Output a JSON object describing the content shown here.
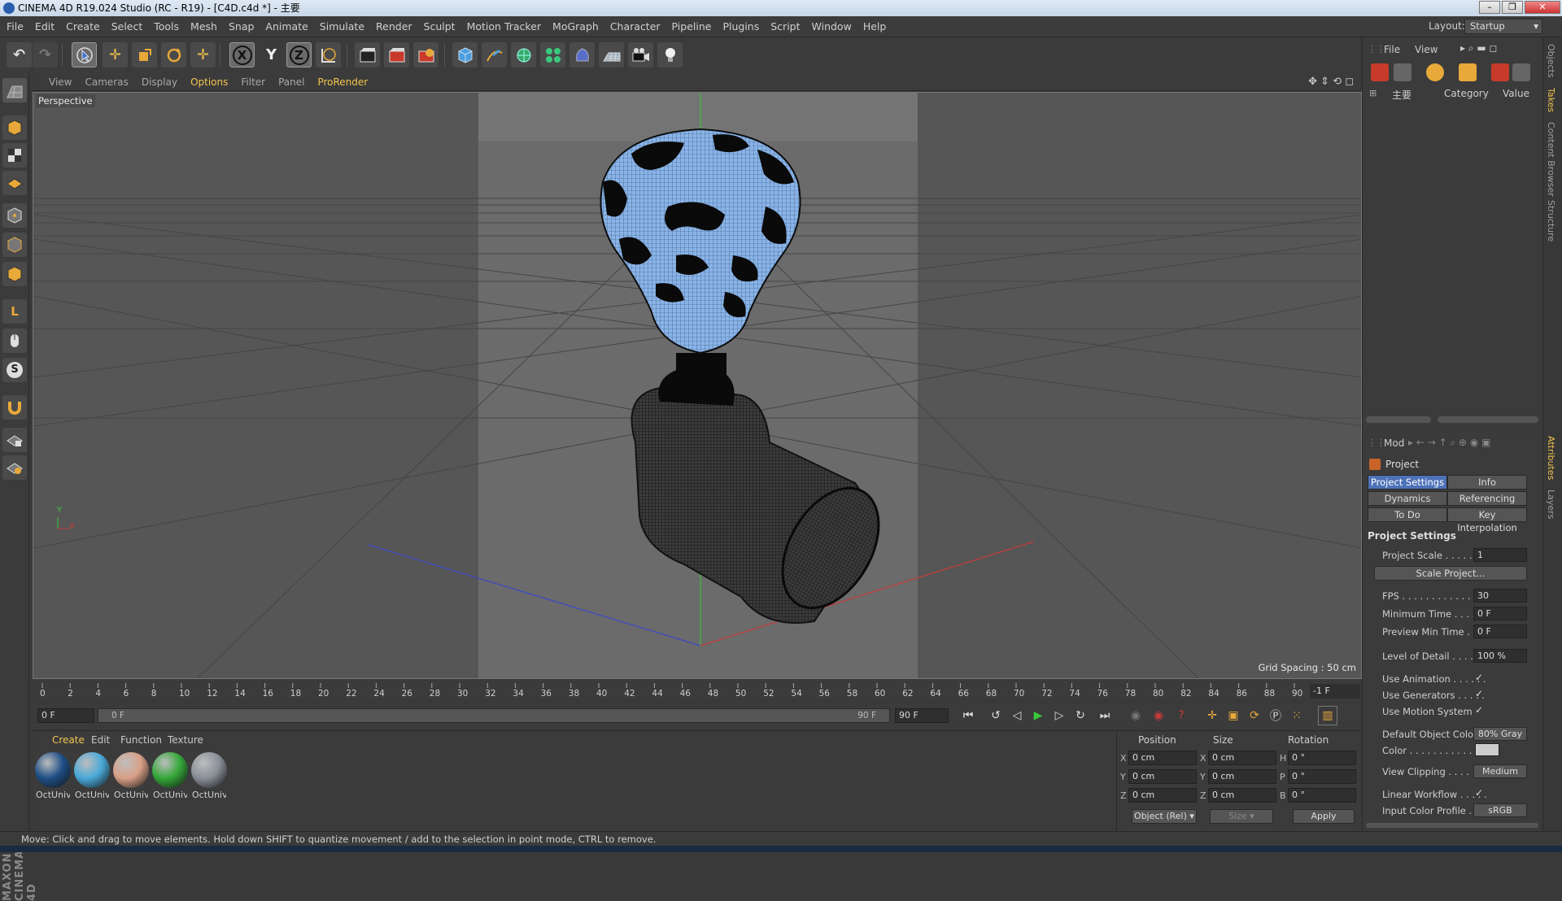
{
  "window": {
    "title": "CINEMA 4D R19.024 Studio (RC - R19) - [C4D.c4d *] - 主要"
  },
  "menubar": {
    "items": [
      "File",
      "Edit",
      "Create",
      "Select",
      "Tools",
      "Mesh",
      "Snap",
      "Animate",
      "Simulate",
      "Render",
      "Sculpt",
      "Motion Tracker",
      "MoGraph",
      "Character",
      "Pipeline",
      "Plugins",
      "Script",
      "Window",
      "Help"
    ],
    "layout_label": "Layout:",
    "layout_value": "Startup"
  },
  "toolbar": {
    "icons": [
      "undo-icon",
      "redo-icon",
      "live-selection-icon",
      "move-icon",
      "scale-icon",
      "rotate-icon",
      "move-axis-icon",
      "x-axis-lock-icon",
      "y-axis-lock-icon",
      "z-axis-lock-icon",
      "world-coordinates-icon",
      "render-view-icon",
      "render-picture-viewer-icon",
      "edit-render-settings-icon",
      "cube-icon",
      "pen-spline-icon",
      "subdivision-surface-icon",
      "cloner-icon",
      "deformer-icon",
      "floor-icon",
      "camera-icon",
      "light-icon"
    ]
  },
  "viewport": {
    "menu": [
      "View",
      "Cameras",
      "Display",
      "Options",
      "Filter",
      "Panel",
      "ProRender"
    ],
    "label": "Perspective",
    "grid_spacing": "Grid Spacing : 50 cm",
    "axis_y": "Y",
    "axis_x": "X"
  },
  "timeline": {
    "ticks": [
      "0",
      "2",
      "4",
      "6",
      "8",
      "10",
      "12",
      "14",
      "16",
      "18",
      "20",
      "22",
      "24",
      "26",
      "28",
      "30",
      "32",
      "34",
      "36",
      "38",
      "40",
      "42",
      "44",
      "46",
      "48",
      "50",
      "52",
      "54",
      "56",
      "58",
      "60",
      "62",
      "64",
      "66",
      "68",
      "70",
      "72",
      "74",
      "76",
      "78",
      "80",
      "82",
      "84",
      "86",
      "88",
      "90"
    ],
    "current_frame": "-1 F",
    "start_field": "0 F",
    "range_start": "0 F",
    "range_end": "90 F",
    "end_field": "90 F"
  },
  "materials": {
    "menu": [
      "Create",
      "Edit",
      "Function",
      "Texture"
    ],
    "items": [
      {
        "label": "OctUniv",
        "color": "#1f4f86"
      },
      {
        "label": "OctUniv",
        "color": "#4aa9d8"
      },
      {
        "label": "OctUniv",
        "color": "#d9a088"
      },
      {
        "label": "OctUniv",
        "color": "#35a83a"
      },
      {
        "label": "OctUniv",
        "color": "#8a9098"
      }
    ]
  },
  "coordinates": {
    "headers": [
      "Position",
      "Size",
      "Rotation"
    ],
    "rows": [
      {
        "axis": "X",
        "pos": "0 cm",
        "saxis": "X",
        "size": "0 cm",
        "raxis": "H",
        "rot": "0 °"
      },
      {
        "axis": "Y",
        "pos": "0 cm",
        "saxis": "Y",
        "size": "0 cm",
        "raxis": "P",
        "rot": "0 °"
      },
      {
        "axis": "Z",
        "pos": "0 cm",
        "saxis": "Z",
        "size": "0 cm",
        "raxis": "B",
        "rot": "0 °"
      }
    ],
    "mode": "Object (Rel)",
    "size_mode": "Size",
    "apply": "Apply"
  },
  "status": "Move: Click and drag to move elements. Hold down SHIFT to quantize movement / add to the selection in point mode, CTRL to remove.",
  "objects_panel": {
    "menu": [
      "File",
      "View"
    ],
    "root_item": "主要",
    "columns": [
      "Category",
      "Value"
    ]
  },
  "attributes": {
    "mode_label": "Mod",
    "object_name": "Project",
    "tabs": [
      "Project Settings",
      "Info",
      "Dynamics",
      "Referencing",
      "To Do",
      "Key Interpolation"
    ],
    "section": "Project Settings",
    "rows": [
      {
        "label": "Project Scale . . . . . . .",
        "value": "1"
      },
      {
        "label": "FPS . . . . . . . . . . . . . . .",
        "value": "30"
      },
      {
        "label": "Minimum Time . . . . . .",
        "value": "0 F"
      },
      {
        "label": "Preview Min Time . . . .",
        "value": "0 F"
      },
      {
        "label": "Level of Detail . . . . . .",
        "value": "100 %"
      },
      {
        "label": "Use Animation . . . . . .",
        "value": "✓"
      },
      {
        "label": "Use Generators . . . . .",
        "value": "✓"
      },
      {
        "label": "Use Motion System",
        "value": "✓"
      },
      {
        "label": "Default Object Color",
        "value": "80% Gray"
      },
      {
        "label": "Color . . . . . . . . . . . .",
        "value": ""
      },
      {
        "label": "View Clipping . . . . . .",
        "value": "Medium"
      },
      {
        "label": "Linear Workflow . . . . .",
        "value": "✓"
      },
      {
        "label": "Input Color Profile . . .",
        "value": "sRGB"
      }
    ],
    "scale_button": "Scale Project..."
  },
  "side_tabs": [
    "Objects",
    "Takes",
    "Content Browser",
    "Structure",
    "Attributes",
    "Layers"
  ],
  "colors": {
    "accent": "#f2c44d",
    "selection_blue": "#4e72b8",
    "mesh_blue": "#8ab4e8",
    "axis_red": "#c83a3a",
    "axis_blue": "#3a4ac8",
    "axis_green": "#3ac83a"
  }
}
